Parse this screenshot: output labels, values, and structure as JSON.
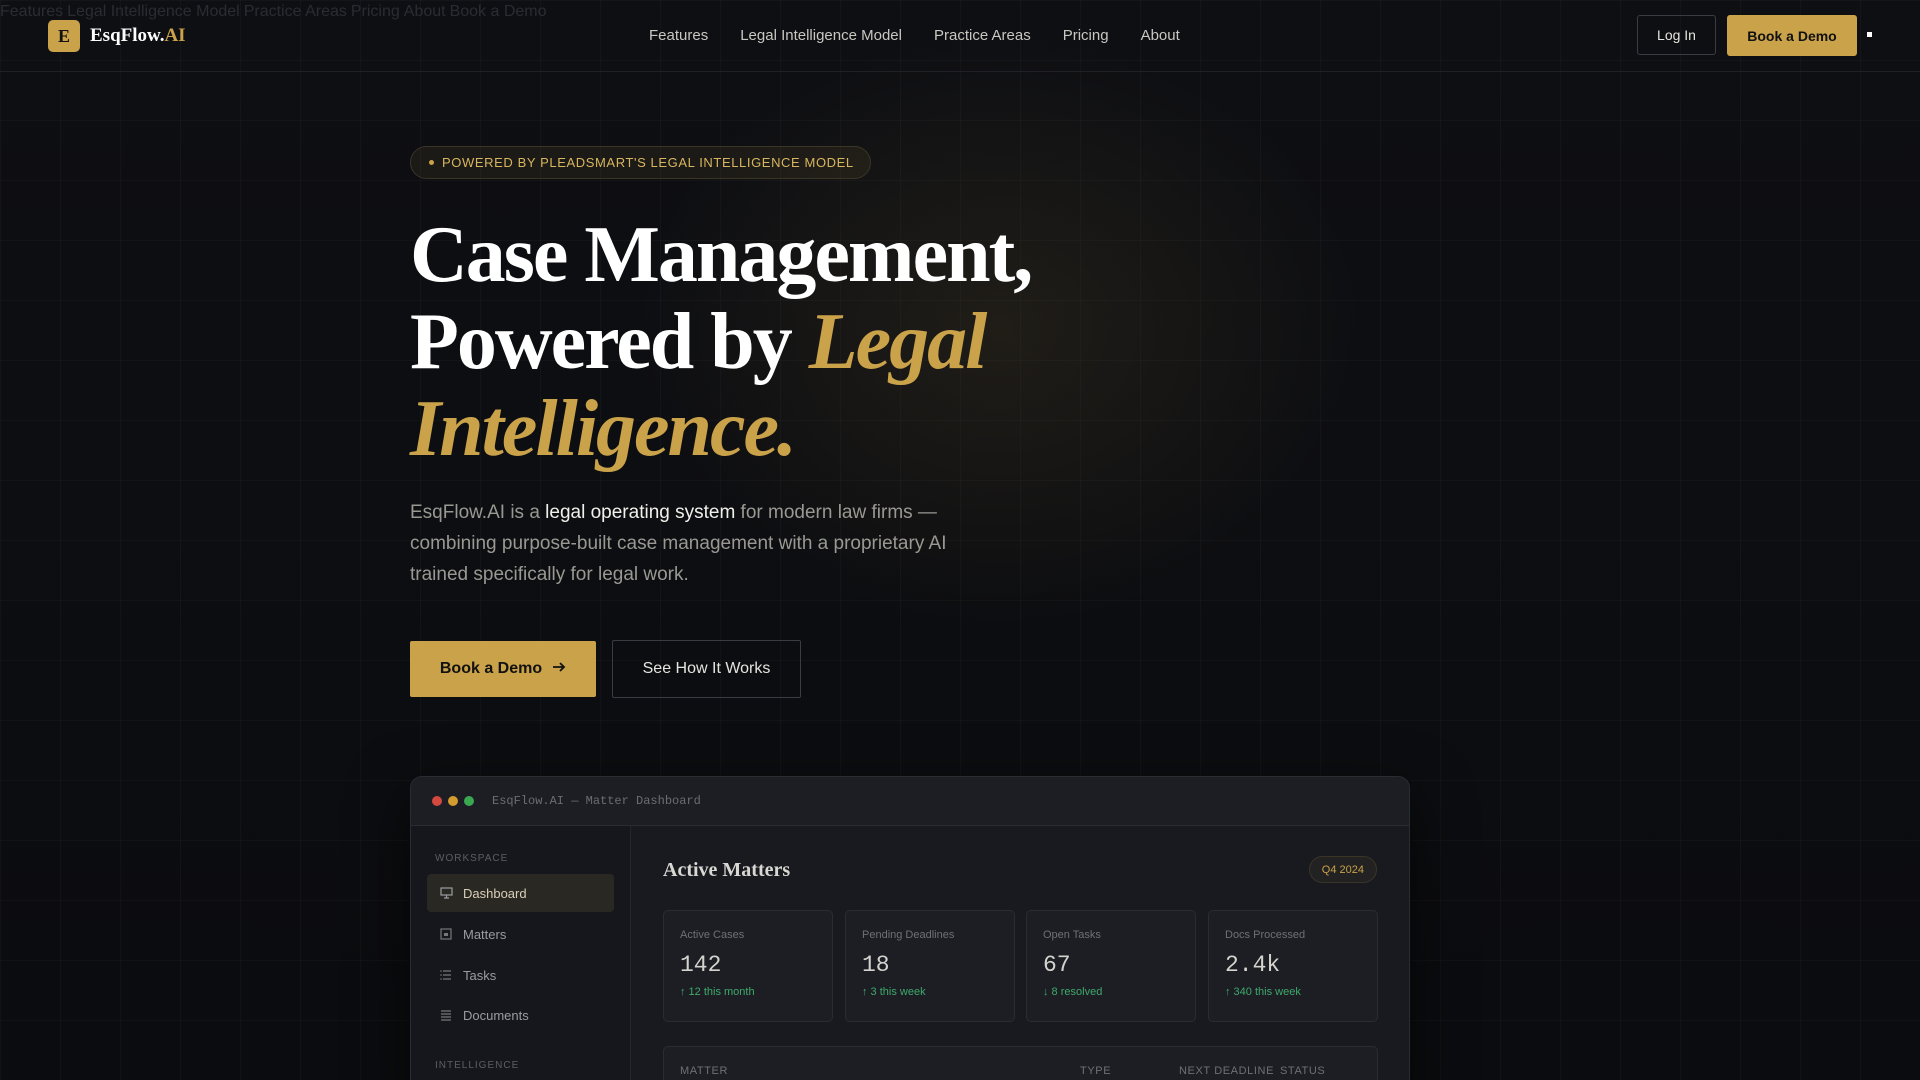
{
  "skip_links": [
    "Features",
    "Legal Intelligence Model",
    "Practice Areas",
    "Pricing",
    "About",
    "Book a Demo"
  ],
  "brand": {
    "mark": "E",
    "name": "EsqFlow.",
    "name_accent": "AI"
  },
  "nav": {
    "links": [
      "Features",
      "Legal Intelligence Model",
      "Practice Areas",
      "Pricing",
      "About"
    ],
    "login": "Log In",
    "demo": "Book a Demo"
  },
  "hero": {
    "pill": "POWERED BY PLEADSMART'S LEGAL INTELLIGENCE MODEL",
    "line1": "Case Management,",
    "line2": "Powered by ",
    "line2_gold": "Legal",
    "line3_gold": "Intelligence.",
    "sub_prefix": "EsqFlow.AI is a ",
    "sub_highlight": "legal operating system",
    "sub_suffix": " for modern law firms — combining purpose-built case management with a proprietary AI trained specifically for legal work.",
    "cta_primary": "Book a Demo",
    "cta_secondary": "See How It Works"
  },
  "dashboard": {
    "window_title": "EsqFlow.AI — Matter Dashboard",
    "dot_colors": [
      "#d4493f",
      "#d49b2f",
      "#3aa851"
    ],
    "workspace_heading": "WORKSPACE",
    "menu": [
      {
        "label": "Dashboard",
        "icon": "monitor-icon"
      },
      {
        "label": "Matters",
        "icon": "folder-icon"
      },
      {
        "label": "Tasks",
        "icon": "list-icon"
      },
      {
        "label": "Documents",
        "icon": "documents-icon"
      }
    ],
    "intelligence_heading": "INTELLIGENCE",
    "title": "Active Matters",
    "period": "Q4 2024",
    "stats": [
      {
        "label": "Active Cases",
        "value": "142",
        "delta": "↑ 12 this month"
      },
      {
        "label": "Pending Deadlines",
        "value": "18",
        "delta": "↑ 3 this week"
      },
      {
        "label": "Open Tasks",
        "value": "67",
        "delta": "↓ 8 resolved"
      },
      {
        "label": "Docs Processed",
        "value": "2.4k",
        "delta": "↑ 340 this week"
      }
    ],
    "columns": [
      "MATTER",
      "TYPE",
      "NEXT DEADLINE",
      "STATUS"
    ]
  },
  "colors": {
    "accent": "#c9a24a",
    "background": "#0c0d10",
    "positive": "#3fa96b"
  }
}
